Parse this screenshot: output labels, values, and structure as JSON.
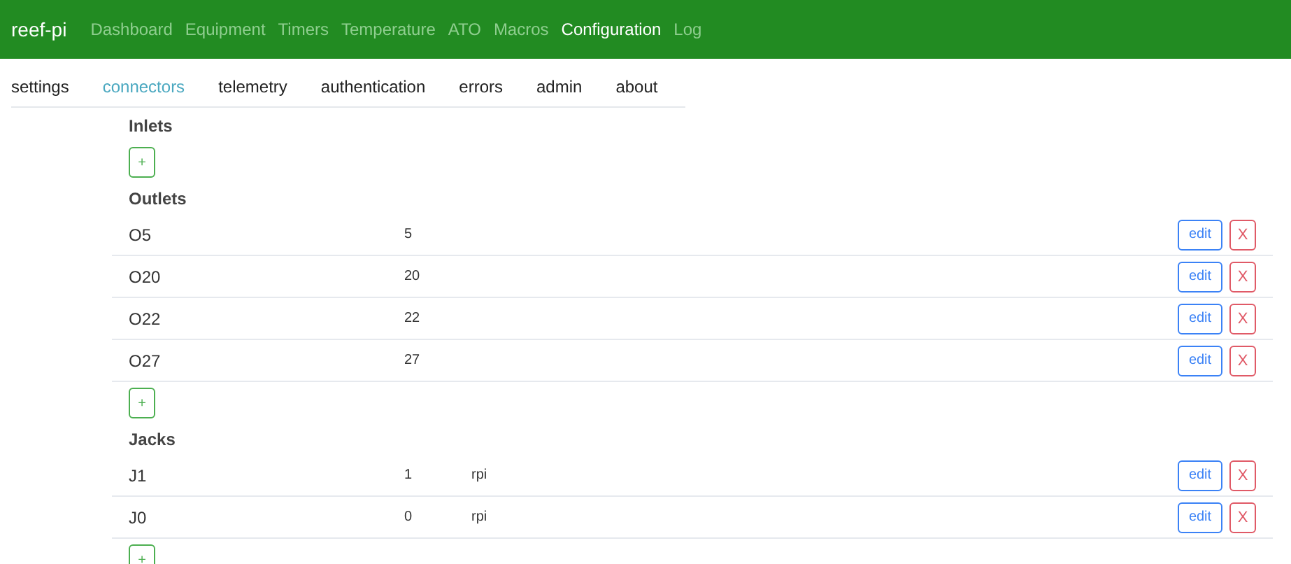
{
  "navbar": {
    "brand": "reef-pi",
    "items": [
      {
        "label": "Dashboard",
        "selected": false
      },
      {
        "label": "Equipment",
        "selected": false
      },
      {
        "label": "Timers",
        "selected": false
      },
      {
        "label": "Temperature",
        "selected": false
      },
      {
        "label": "ATO",
        "selected": false
      },
      {
        "label": "Macros",
        "selected": false
      },
      {
        "label": "Configuration",
        "selected": true
      },
      {
        "label": "Log",
        "selected": false
      }
    ]
  },
  "tabs": [
    {
      "label": "settings",
      "selected": false
    },
    {
      "label": "connectors",
      "selected": true
    },
    {
      "label": "telemetry",
      "selected": false
    },
    {
      "label": "authentication",
      "selected": false
    },
    {
      "label": "errors",
      "selected": false
    },
    {
      "label": "admin",
      "selected": false
    },
    {
      "label": "about",
      "selected": false
    }
  ],
  "sections": [
    {
      "title": "Inlets",
      "add_button": "+"
    },
    {
      "title": "Outlets",
      "rows": [
        {
          "name": "O5",
          "pin": "5",
          "edit": "edit",
          "delete": "X"
        },
        {
          "name": "O20",
          "pin": "20",
          "edit": "edit",
          "delete": "X"
        },
        {
          "name": "O22",
          "pin": "22",
          "edit": "edit",
          "delete": "X"
        },
        {
          "name": "O27",
          "pin": "27",
          "edit": "edit",
          "delete": "X"
        }
      ],
      "add_button": "+"
    },
    {
      "title": "Jacks",
      "rows": [
        {
          "name": "J1",
          "pin": "1",
          "driver": "rpi",
          "edit": "edit",
          "delete": "X"
        },
        {
          "name": "J0",
          "pin": "0",
          "driver": "rpi",
          "edit": "edit",
          "delete": "X"
        }
      ],
      "add_button": "+"
    }
  ]
}
